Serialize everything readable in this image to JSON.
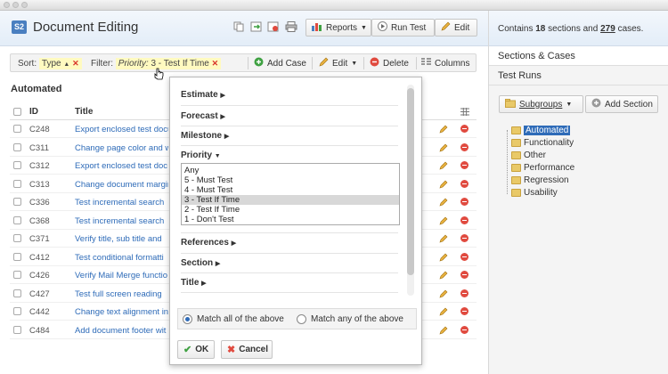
{
  "header": {
    "badge": "S2",
    "title": "Document Editing",
    "buttons": {
      "reports": "Reports",
      "run_test": "Run Test",
      "edit": "Edit"
    },
    "icons": [
      "copy-icon",
      "move-icon",
      "export-icon",
      "print-icon"
    ]
  },
  "toolbar": {
    "sort_label": "Sort:",
    "sort_value": "Type",
    "filter_label": "Filter:",
    "filter_field": "Priority:",
    "filter_value": "3 - Test If Time",
    "add_case": "Add Case",
    "edit": "Edit",
    "delete": "Delete",
    "columns": "Columns"
  },
  "section": {
    "title": "Automated"
  },
  "table": {
    "columns": [
      "ID",
      "Title"
    ],
    "rows": [
      {
        "id": "C248",
        "title": "Export enclosed test docu"
      },
      {
        "id": "C311",
        "title": "Change page color and w"
      },
      {
        "id": "C312",
        "title": "Export enclosed test doc"
      },
      {
        "id": "C313",
        "title": "Change document margin"
      },
      {
        "id": "C336",
        "title": "Test incremental search"
      },
      {
        "id": "C368",
        "title": "Test incremental search"
      },
      {
        "id": "C371",
        "title": "Verify title, sub title and"
      },
      {
        "id": "C412",
        "title": "Test conditional formatti"
      },
      {
        "id": "C426",
        "title": "Verify Mail Merge functio"
      },
      {
        "id": "C427",
        "title": "Test full screen reading"
      },
      {
        "id": "C442",
        "title": "Change text alignment in"
      },
      {
        "id": "C484",
        "title": "Add document footer wit"
      }
    ]
  },
  "filter_panel": {
    "fields": {
      "estimate": "Estimate",
      "forecast": "Forecast",
      "milestone": "Milestone",
      "priority": "Priority",
      "references": "References",
      "section": "Section",
      "title": "Title"
    },
    "priority_options": [
      "Any",
      "5 - Must Test",
      "4 - Must Test",
      "3 - Test If Time",
      "2 - Test If Time",
      "1 - Don't Test"
    ],
    "selected_option": "3 - Test If Time",
    "match_all": "Match all of the above",
    "match_any": "Match any of the above",
    "ok": "OK",
    "cancel": "Cancel"
  },
  "sidebar": {
    "summary_prefix": "Contains",
    "sections_count": "18",
    "summary_mid": "sections and",
    "cases_count": "279",
    "summary_suffix": "cases.",
    "tabs": [
      "Sections & Cases",
      "Test Runs"
    ],
    "subgroups": "Subgroups",
    "add_section": "Add Section",
    "tree": [
      "Automated",
      "Functionality",
      "Other",
      "Performance",
      "Regression",
      "Usability"
    ]
  },
  "colors": {
    "accent": "#2e6bb8",
    "delete": "#e04a3f",
    "add": "#3fa142",
    "filter_highlight": "#fffac0"
  }
}
